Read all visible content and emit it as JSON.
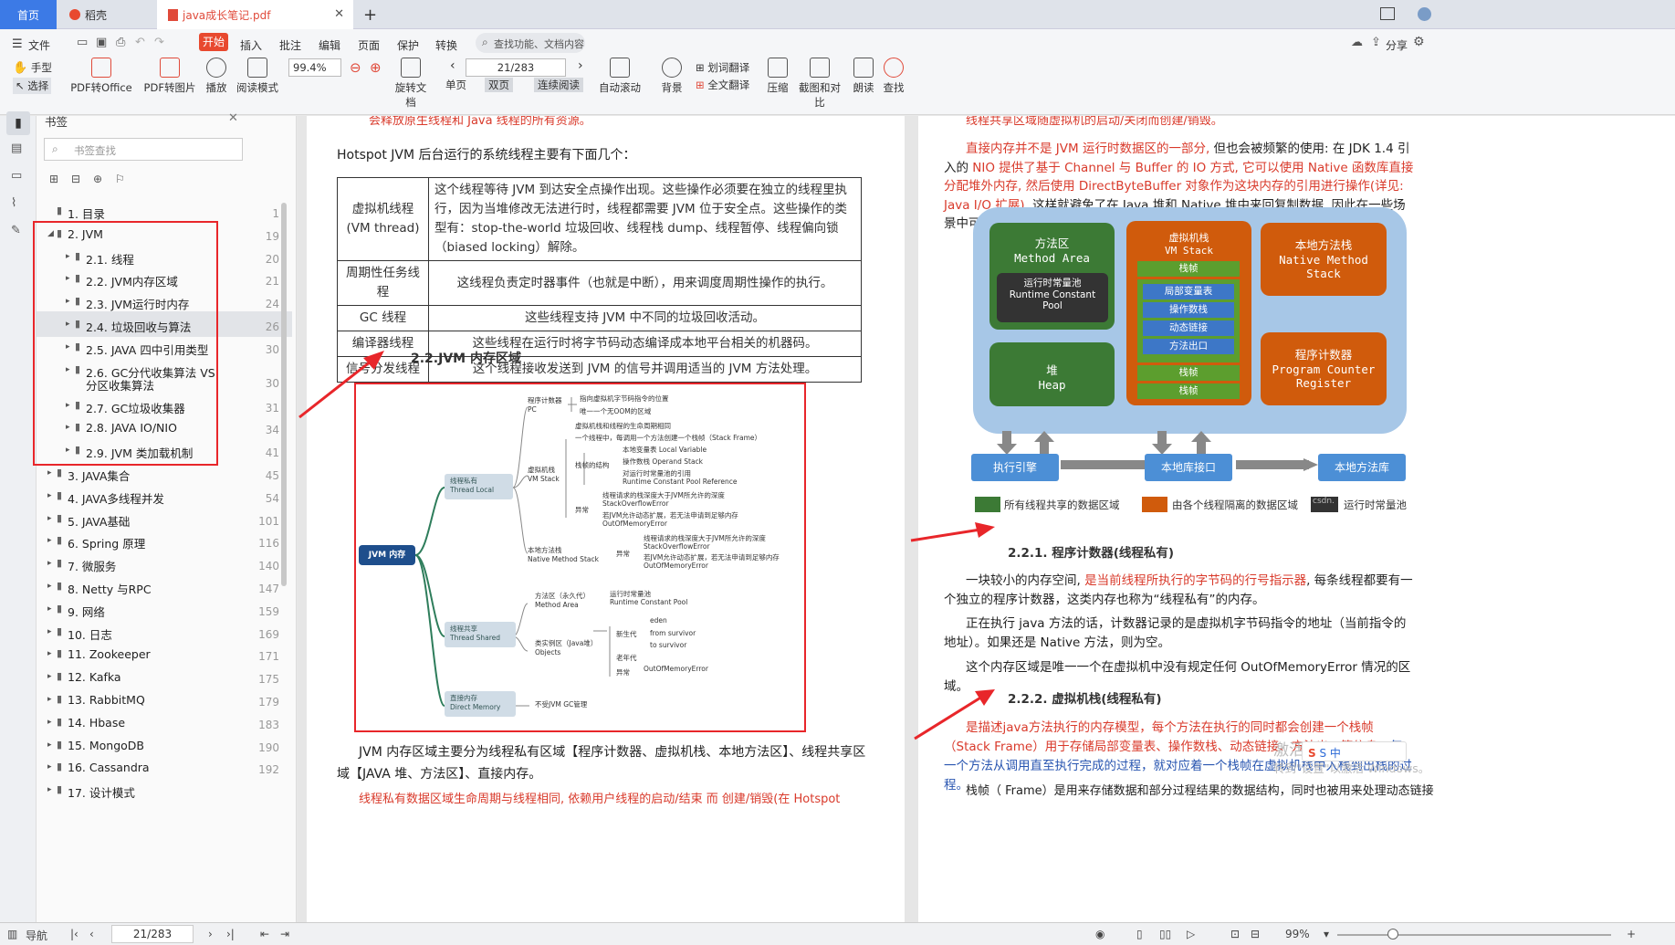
{
  "tabs": {
    "home": "首页",
    "wps": "稻壳",
    "doc": "java成长笔记.pdf",
    "add": "+"
  },
  "menu": {
    "file": "文件",
    "start": "开始",
    "insert": "插入",
    "annotate": "批注",
    "edit": "编辑",
    "page": "页面",
    "protect": "保护",
    "convert": "转换",
    "search": "查找功能、文档内容",
    "share": "分享"
  },
  "toolbar": {
    "hand": "手型",
    "select": "选择",
    "pdf2office": "PDF转Office",
    "pdf2img": "PDF转图片",
    "play": "播放",
    "readmode": "阅读模式",
    "zoom": "99.4%",
    "rotate": "旋转文档",
    "single": "单页",
    "double": "双页",
    "continuous": "连续阅读",
    "page": "21/283",
    "autoscroll": "自动滚动",
    "bg": "背景",
    "wordtrans": "划词翻译",
    "fulltrans": "全文翻译",
    "compress": "压缩",
    "screenshot": "截图和对比",
    "read": "朗读",
    "find": "查找"
  },
  "sidebar": {
    "title": "书签",
    "search_placeholder": "书签查找",
    "items": [
      {
        "label": "1. 目录",
        "page": "1"
      },
      {
        "label": "2. JVM",
        "page": "19"
      },
      {
        "label": "2.1. 线程",
        "page": "20"
      },
      {
        "label": "2.2. JVM内存区域",
        "page": "21"
      },
      {
        "label": "2.3. JVM运行时内存",
        "page": "24"
      },
      {
        "label": "2.4. 垃圾回收与算法",
        "page": "26"
      },
      {
        "label": "2.5. JAVA 四中引用类型",
        "page": "30"
      },
      {
        "label": "2.6. GC分代收集算法  VS",
        "label2": "分区收集算法",
        "page": "30"
      },
      {
        "label": "2.7. GC垃圾收集器",
        "page": "31"
      },
      {
        "label": "2.8.  JAVA IO/NIO",
        "page": "34"
      },
      {
        "label": "2.9. JVM 类加载机制",
        "page": "41"
      },
      {
        "label": "3. JAVA集合",
        "page": "45"
      },
      {
        "label": "4. JAVA多线程并发",
        "page": "54"
      },
      {
        "label": "5. JAVA基础",
        "page": "101"
      },
      {
        "label": "6. Spring 原理",
        "page": "116"
      },
      {
        "label": "7.   微服务",
        "page": "140"
      },
      {
        "label": "8. Netty 与RPC",
        "page": "147"
      },
      {
        "label": "9. 网络",
        "page": "159"
      },
      {
        "label": "10. 日志",
        "page": "169"
      },
      {
        "label": "11. Zookeeper",
        "page": "171"
      },
      {
        "label": "12. Kafka",
        "page": "175"
      },
      {
        "label": "13. RabbitMQ",
        "page": "179"
      },
      {
        "label": "14. Hbase",
        "page": "183"
      },
      {
        "label": "15. MongoDB",
        "page": "190"
      },
      {
        "label": "16. Cassandra",
        "page": "192"
      },
      {
        "label": "17. 设计模式",
        "page": ""
      }
    ]
  },
  "left": {
    "top_red": "会释放原生线程和 Java 线程的所有资源。",
    "intro": "Hotspot JVM 后台运行的系统线程主要有下面几个：",
    "table": [
      [
        "虚拟机线程\n(VM thread)",
        "这个线程等待 JVM 到达安全点操作出现。这些操作必须要在独立的线程里执行，因为当堆修改无法进行时，线程都需要 JVM 位于安全点。这些操作的类型有：stop-the-world 垃圾回收、线程栈 dump、线程暂停、线程偏向锁（biased locking）解除。"
      ],
      [
        "周期性任务线程",
        "这线程负责定时器事件（也就是中断），用来调度周期性操作的执行。"
      ],
      [
        "GC 线程",
        "这些线程支持 JVM 中不同的垃圾回收活动。"
      ],
      [
        "编译器线程",
        "这些线程在运行时将字节码动态编译成本地平台相关的机器码。"
      ],
      [
        "信号分发线程",
        "这个线程接收发送到 JVM 的信号并调用适当的 JVM 方法处理。"
      ]
    ],
    "heading": "2.2.JVM 内存区域",
    "mind": {
      "root": "JVM 内存",
      "private": "线程私有\nThread Local",
      "shared": "线程共享\nThread Shared",
      "direct": "直接内存\nDirect Memory",
      "pc": "程序计数器\nPC",
      "pc1": "指向虚拟机字节码指令的位置",
      "pc2": "唯一一个无OOM的区域",
      "vms": "虚拟机栈\nVM Stack",
      "vms1": "虚拟机栈和线程的生命周期相同",
      "vms2": "一个线程中，每调用一个方法创建一个栈帧（Stack Frame）",
      "frame": "栈帧的结构",
      "f1": "本地变量表 Local Variable",
      "f2": "操作数栈 Operand Stack",
      "f3": "对运行时常量池的引用",
      "f4": "Runtime Constant Pool Reference",
      "ex": "异常",
      "e1": "线程请求的栈深度大于JVM所允许的深度",
      "e2": "StackOverflowError",
      "e3": "若JVM允许动态扩展，若无法申请到足够内存",
      "e4": "OutOfMemoryError",
      "nms": "本地方法栈\nNative Method Stack",
      "nex": "异常",
      "n1": "线程请求的栈深度大于JVM所允许的深度",
      "n2": "StackOverflowError",
      "n3": "若JVM允许动态扩展，若无法申请到足够内存",
      "n4": "OutOfMemoryError",
      "ma": "方法区（永久代）\nMethod Area",
      "ma1": "运行时常量池",
      "ma2": "Runtime Constant Pool",
      "obj": "类实例区（Java堆）\nObjects",
      "young": "新生代",
      "eden": "eden",
      "from": "from survivor",
      "to": "to survivor",
      "old": "老年代",
      "oex": "异常",
      "oom": "OutOfMemoryError",
      "dm1": "不受JVM GC管理"
    },
    "para1": "JVM 内存区域主要分为线程私有区域【程序计数器、虚拟机栈、本地方法区】、线程共享区域【JAVA 堆、方法区】、直接内存。",
    "para2_red": "线程私有数据区域生命周期与线程相同, 依赖用户线程的启动/结束 而 创建/销毁(在 Hotspot"
  },
  "right": {
    "top_red": "线程共享区域随虚拟机的启动/关闭而创建/销毁。",
    "p1_red": "直接内存并不是 JVM 运行时数据区的一部分,",
    "p1a": " 但也会被频繁的使用: 在 JDK 1.4 引入的",
    "p1b_red": " NIO 提供了基于 Channel 与 Buffer 的 IO 方式, 它可以使用 Native 函数库直接分配堆外内存, 然后使用 DirectByteBuffer 对象作为这块内存的引用进行操作(详见: Java I/O 扩展),",
    "p1c": " 这样就避免了在 Java 堆和 Native 堆中来回复制数据, 因此在一些场景中可以显著提高性能。",
    "diag": {
      "ma": "方法区\nMethod Area",
      "rcp": "运行时常量池\nRuntime Constant\nPool",
      "heap": "堆\nHeap",
      "vms": "虚拟机栈\nVM Stack",
      "frame": "栈帧",
      "lv": "局部变量表",
      "os": "操作数栈",
      "dl": "动态链接",
      "ret": "方法出口",
      "nms": "本地方法栈\nNative Method\nStack",
      "pc": "程序计数器\nProgram Counter\nRegister",
      "engine": "执行引擎",
      "native_if": "本地库接口",
      "native_lib": "本地方法库",
      "leg1": "所有线程共享的数据区域",
      "leg2": "由各个线程隔离的数据区域",
      "leg3": "运行时常量池",
      "leg3_mark": "csdn."
    },
    "h221": "2.2.1.  程序计数器(线程私有)",
    "p2a": "一块较小的内存空间,",
    "p2b_red": " 是当前线程所执行的字节码的行号指示器",
    "p2c": ", 每条线程都要有一个独立的程序计数器，这类内存也称为“线程私有”的内存。",
    "p3": "正在执行 java 方法的话，计数器记录的是虚拟机字节码指令的地址（当前指令的地址）。如果还是 Native 方法，则为空。",
    "p4": "这个内存区域是唯一一个在虚拟机中没有规定任何 OutOfMemoryError 情况的区域。",
    "h222": "2.2.2.  虚拟机栈(线程私有)",
    "p5_red": "是描述java方法执行的内存模型，每个方法在执行的同时都会创建一个栈帧（Stack Frame）用于存储局部变量表、操作数栈、动态链接、方法出口等信息。",
    "p5_blue": "每一个方法从调用直至执行完成的过程，就对应着一个栈帧在虚拟机栈中入栈到出栈的过程。",
    "p6": "栈帧（ Frame）是用来存储数据和部分过程结果的数据结构，同时也被用来处理动态链接",
    "watermark1": "激活 Windows",
    "watermark2": "转到\"设置\"以激活 Windows。"
  },
  "status": {
    "nav": "导航",
    "page": "21/283",
    "zoom": "99%"
  },
  "ime": "S 中"
}
